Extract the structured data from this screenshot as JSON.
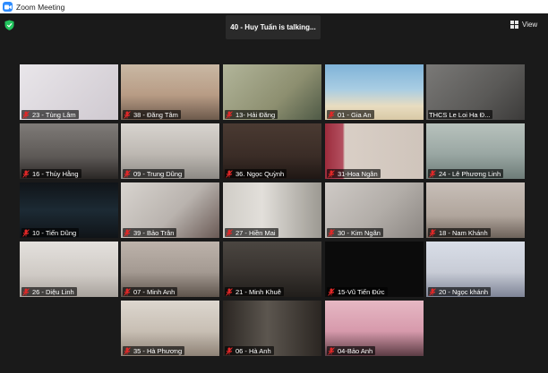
{
  "window": {
    "title": "Zoom Meeting"
  },
  "header": {
    "talking_indicator": "40 - Huy Tuấn is talking...",
    "view_label": "View"
  },
  "colors": {
    "accent": "#2d8cff",
    "shield": "#23c55e",
    "mic_muted": "#e02828",
    "background": "#1a1a1a"
  },
  "participants": [
    {
      "name": "23 - Tùng Lâm",
      "muted": true,
      "bg": "linear-gradient(135deg,#e9e6ea,#cfc9d0)"
    },
    {
      "name": "38 - Đăng Tâm",
      "muted": true,
      "bg": "linear-gradient(180deg,#c9b8a4 0%,#b89c85 55%,#6d5a4c 100%)"
    },
    {
      "name": "13- Hải Đăng",
      "muted": true,
      "bg": "linear-gradient(135deg,#b2b59a,#8d8f70 60%,#4f5a46)"
    },
    {
      "name": "01 - Gia An",
      "muted": true,
      "bg": "linear-gradient(180deg,#7fb3d8 0%,#a9cde3 45%,#e8dcc0 75%,#d9c9a6 100%)"
    },
    {
      "name": "THCS Le Loi Ha Đ...",
      "muted": false,
      "bg": "linear-gradient(135deg,#7a7977,#5a5957 60%,#3c3b3a)"
    },
    {
      "name": "16 - Thủy Hằng",
      "muted": true,
      "bg": "linear-gradient(180deg,#7f7b78,#5d5956 60%,#2a2725)"
    },
    {
      "name": "09 - Trung Dũng",
      "muted": true,
      "bg": "linear-gradient(180deg,#d8d4cf,#bdb8b2 55%,#8d8a85)"
    },
    {
      "name": "36. Ngọc Quỳnh",
      "muted": true,
      "bg": "linear-gradient(180deg,#4a3a32,#3a2c26 60%,#1f1714)"
    },
    {
      "name": "31-Hoa Ngân",
      "muted": true,
      "bg": "linear-gradient(90deg,#9c2c3c 0%,#b35060 18%,#d9cfc6 20%,#cfc4bb 100%)"
    },
    {
      "name": "24 - Lê Phương Linh",
      "muted": true,
      "bg": "linear-gradient(180deg,#b8c2bd,#9aa7a3 55%,#6e7c78)"
    },
    {
      "name": "10 - Tiến Dũng",
      "muted": true,
      "bg": "linear-gradient(180deg,#101418,#1c2a34 50%,#101418)"
    },
    {
      "name": "39 - Bảo Trân",
      "muted": true,
      "bg": "linear-gradient(135deg,#d8d4cf,#b9b3ae 55%,#6a5a55)"
    },
    {
      "name": "27 - Hiền Mai",
      "muted": true,
      "bg": "linear-gradient(90deg,#d0cdc7 0%,#e2dfda 40%,#9c9992 100%)"
    },
    {
      "name": "30 - Kim Ngân",
      "muted": true,
      "bg": "linear-gradient(135deg,#cfcac6,#b2ada8 55%,#8b8682)"
    },
    {
      "name": "18 - Nam Khánh",
      "muted": true,
      "bg": "linear-gradient(180deg,#c8bfb8,#b0a59c 60%,#6d625a)"
    },
    {
      "name": "26 - Diệu Linh",
      "muted": true,
      "bg": "linear-gradient(180deg,#e4e1dd,#cfcac5 60%,#a8a29c)"
    },
    {
      "name": "07 - Minh Anh",
      "muted": true,
      "bg": "linear-gradient(180deg,#bdb3ab,#a49a92 55%,#5e544c)"
    },
    {
      "name": "21 - Minh Khuê",
      "muted": true,
      "bg": "linear-gradient(180deg,#4b4641,#3a3531 50%,#211e1b)"
    },
    {
      "name": "15-Vũ Tiến Đức",
      "muted": true,
      "bg": "#0b0b0b"
    },
    {
      "name": "20 - Ngọc khánh",
      "muted": true,
      "bg": "linear-gradient(180deg,#d9dee8,#c8ccd6 55%,#7e8496)"
    },
    {
      "name": "35 - Hà Phương",
      "muted": true,
      "bg": "linear-gradient(180deg,#ddd7cf,#c8bfb4 55%,#8e8276)"
    },
    {
      "name": "06 - Hà Anh",
      "muted": true,
      "bg": "linear-gradient(90deg,#2b2622,#5c564f 45%,#2b2622)"
    },
    {
      "name": "04-Bảo Anh",
      "muted": true,
      "bg": "linear-gradient(180deg,#e6b8c4,#d79aac 55%,#5c3c44)"
    }
  ]
}
